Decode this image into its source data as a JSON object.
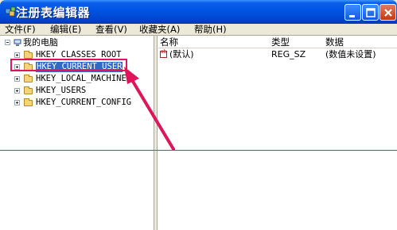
{
  "window": {
    "title": "注册表编辑器",
    "buttons": {
      "minimize": "minimize",
      "maximize": "maximize",
      "close": "close"
    }
  },
  "menu": [
    {
      "label": "文件(F)"
    },
    {
      "label": "编辑(E)"
    },
    {
      "label": "查看(V)"
    },
    {
      "label": "收藏夹(A)"
    },
    {
      "label": "帮助(H)"
    }
  ],
  "tree": {
    "root": "我的电脑",
    "keys": [
      {
        "label": "HKEY_CLASSES_ROOT",
        "selected": false
      },
      {
        "label": "HKEY_CURRENT_USER",
        "selected": true
      },
      {
        "label": "HKEY_LOCAL_MACHINE",
        "selected": false
      },
      {
        "label": "HKEY_USERS",
        "selected": false
      },
      {
        "label": "HKEY_CURRENT_CONFIG",
        "selected": false
      }
    ]
  },
  "list": {
    "columns": [
      "名称",
      "类型",
      "数据"
    ],
    "rows": [
      {
        "name": "(默认)",
        "type": "REG_SZ",
        "data": "(数值未设置)"
      }
    ]
  },
  "annotation": {
    "highlight_color": "#e0145a",
    "arrow_color": "#e0145a",
    "guide_line_color": "#e03030"
  },
  "colors": {
    "titlebar": "#0054e3",
    "chrome": "#ece9d8",
    "selection": "#316ac5"
  }
}
